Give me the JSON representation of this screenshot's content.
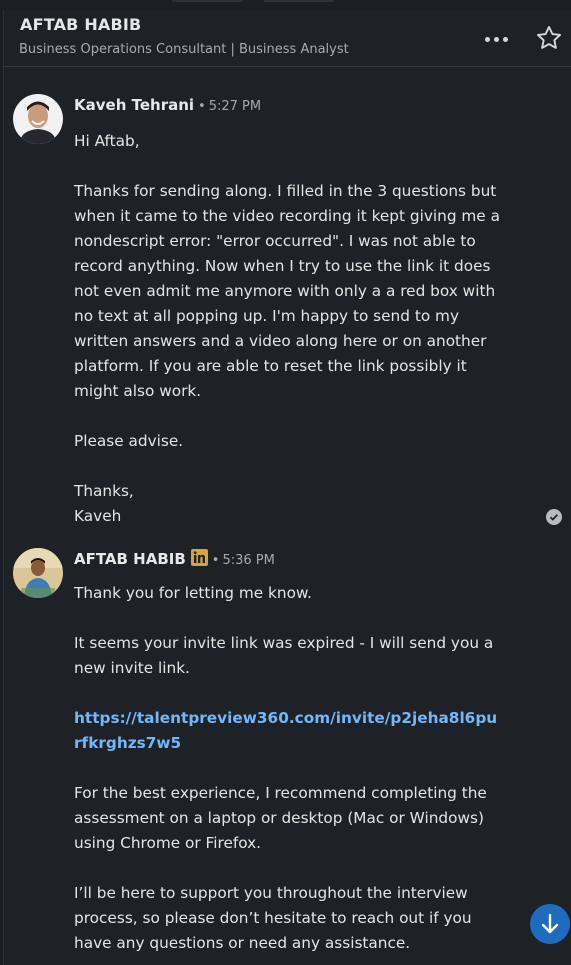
{
  "header": {
    "name": "AFTAB HABIB",
    "subtitle": "Business Operations Consultant | Business Analyst",
    "more_icon": "more-horizontal-icon",
    "star_icon": "star-outline-icon"
  },
  "messages": [
    {
      "sender": "Kaveh Tehrani",
      "time": "5:27 PM",
      "lines": [
        "Hi Aftab,",
        "",
        "Thanks for sending along. I filled in the 3 questions but when it came to the video recording it kept giving me a nondescript error: \"error occurred\".  I was not able to record anything. Now when I try to use the link it does not even admit me anymore with only a a red box with no text at all popping up. I'm happy to send to my written answers and a video along here or on another platform. If you are able to reset the link possibly it might also work.",
        "",
        "Please advise.",
        "",
        "Thanks,",
        "Kaveh"
      ]
    },
    {
      "sender": "AFTAB HABIB",
      "time": "5:36 PM",
      "badge_icon": "linkedin-premium-icon",
      "para1": "Thank you for letting me know.",
      "para2": "It seems your invite link was expired - I will send you a new invite link.",
      "link": "https://talentpreview360.com/invite/p2jeha8l6purfkrghzs7w5",
      "para3": "For the best experience, I recommend completing the assessment on a laptop or desktop (Mac or Windows) using Chrome or Firefox.",
      "para4": "I’ll be here to support you throughout the interview process, so please don’t hesitate to reach out if you have any questions or need any assistance."
    }
  ],
  "separator": "•",
  "colors": {
    "background": "#1e2226",
    "link": "#71b7fb",
    "scroll_button": "#1e6cc0",
    "badge": "#d6a43a"
  }
}
